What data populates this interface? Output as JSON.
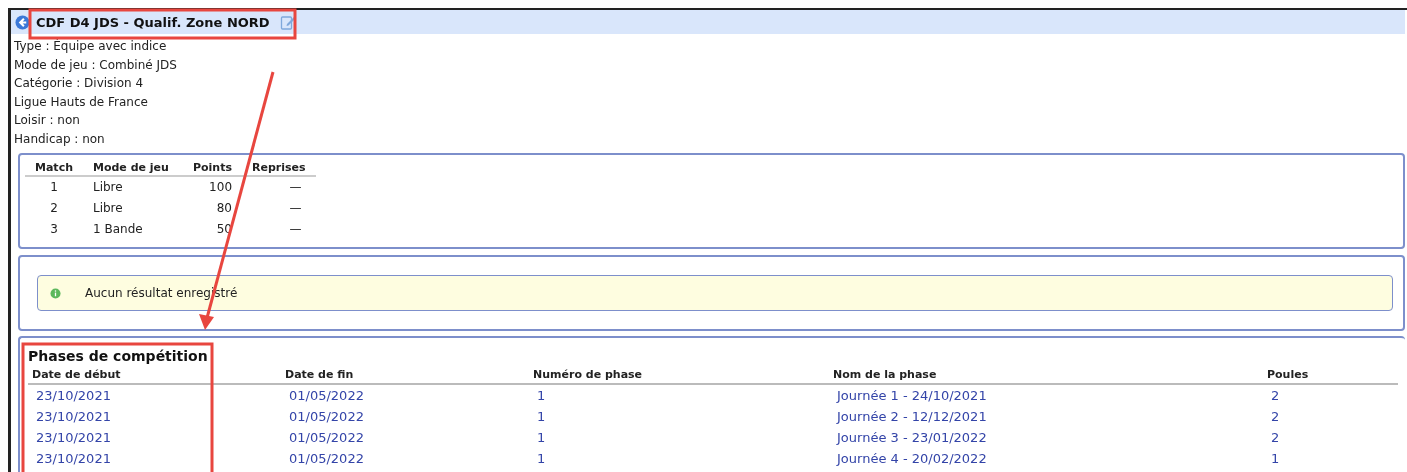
{
  "header": {
    "title": "CDF D4 JDS - Qualif. Zone NORD"
  },
  "details": [
    "Type : Équipe avec indice",
    "Mode de jeu : Combiné JDS",
    "Catégorie : Division 4",
    "Ligue Hauts de France",
    "Loisir : non",
    "Handicap : non"
  ],
  "matches": {
    "columns": [
      "Match",
      "Mode de jeu",
      "Points",
      "Reprises"
    ],
    "rows": [
      [
        "1",
        "Libre",
        "100",
        "—"
      ],
      [
        "2",
        "Libre",
        "80",
        "—"
      ],
      [
        "3",
        "1 Bande",
        "50",
        "—"
      ]
    ]
  },
  "results": {
    "message": "Aucun résultat enregistré"
  },
  "phases": {
    "title": "Phases de compétition",
    "columns": [
      "Date de début",
      "Date de fin",
      "Numéro de phase",
      "Nom de la phase",
      "Poules"
    ],
    "rows": [
      [
        "23/10/2021",
        "01/05/2022",
        "1",
        "Journée 1 - 24/10/2021",
        "2"
      ],
      [
        "23/10/2021",
        "01/05/2022",
        "1",
        "Journée 2 - 12/12/2021",
        "2"
      ],
      [
        "23/10/2021",
        "01/05/2022",
        "1",
        "Journée 3 - 23/01/2022",
        "2"
      ],
      [
        "23/10/2021",
        "01/05/2022",
        "1",
        "Journée 4 - 20/02/2022",
        "1"
      ]
    ]
  }
}
